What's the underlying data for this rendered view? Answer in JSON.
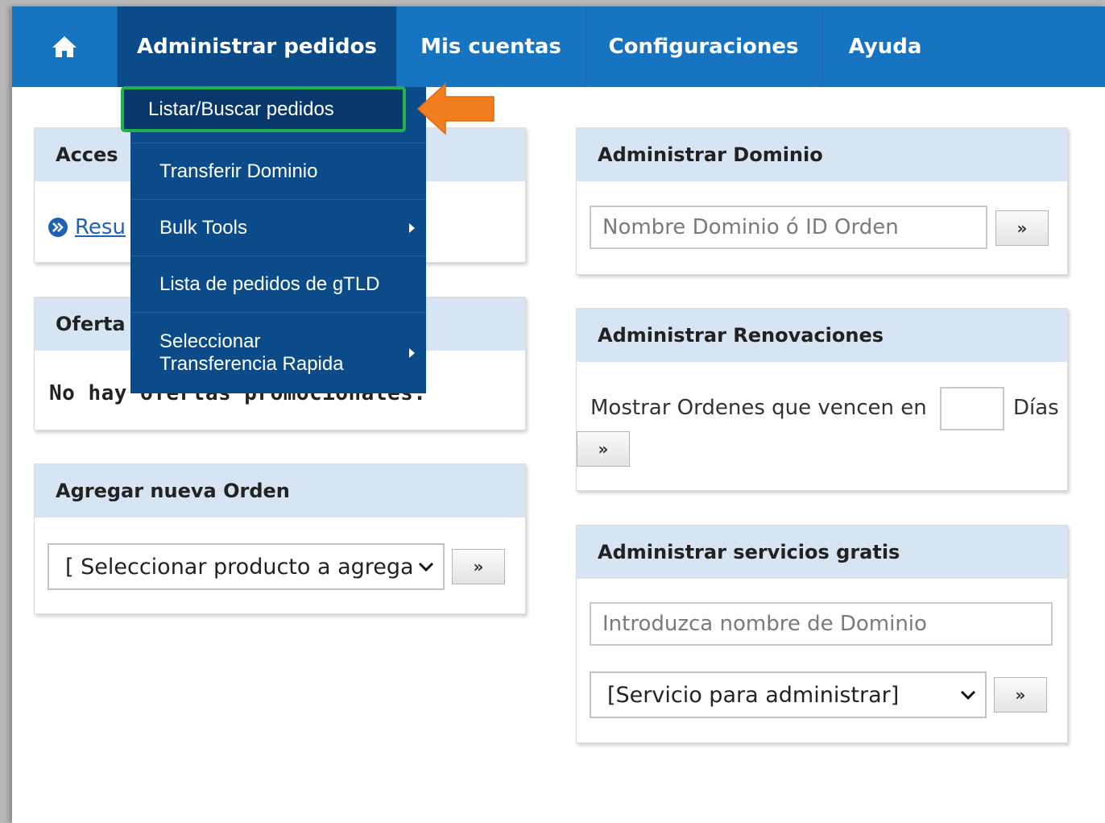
{
  "nav": {
    "home_icon": "home-icon",
    "items": [
      {
        "label": "Administrar pedidos"
      },
      {
        "label": "Mis cuentas"
      },
      {
        "label": "Configuraciones"
      },
      {
        "label": "Ayuda"
      }
    ]
  },
  "dropdown": {
    "items": [
      {
        "label": "Listar/Buscar pedidos",
        "highlighted": true
      },
      {
        "label": "Transferir Dominio"
      },
      {
        "label": "Bulk Tools",
        "has_submenu": true
      },
      {
        "label": "Lista de pedidos de gTLD"
      },
      {
        "label": "Seleccionar Transferencia Rapida",
        "has_submenu": true
      }
    ]
  },
  "left": {
    "access": {
      "title": "Acces",
      "link": "Resu"
    },
    "offers": {
      "title": "Oferta",
      "message": "No hay ofertas promocionales."
    },
    "add_order": {
      "title": "Agregar nueva Orden",
      "select_value": "[ Seleccionar producto a agrega",
      "go_label": "»"
    }
  },
  "right": {
    "domain": {
      "title": "Administrar Dominio",
      "placeholder": "Nombre Dominio ó ID Orden",
      "go_label": "»"
    },
    "renewals": {
      "title": "Administrar Renovaciones",
      "label": "Mostrar Ordenes que vencen en",
      "days_label": "Días",
      "go_label": "»"
    },
    "free": {
      "title": "Administrar servicios gratis",
      "placeholder": "Introduzca nombre de Dominio",
      "select_value": "[Servicio para administrar]",
      "go_label": "»"
    }
  },
  "colors": {
    "navbar": "#1774c1",
    "dropdown": "#0c4b8a",
    "panel_header": "#d6e4f3",
    "highlight_border": "#22b04a",
    "arrow": "#f07d1e"
  }
}
